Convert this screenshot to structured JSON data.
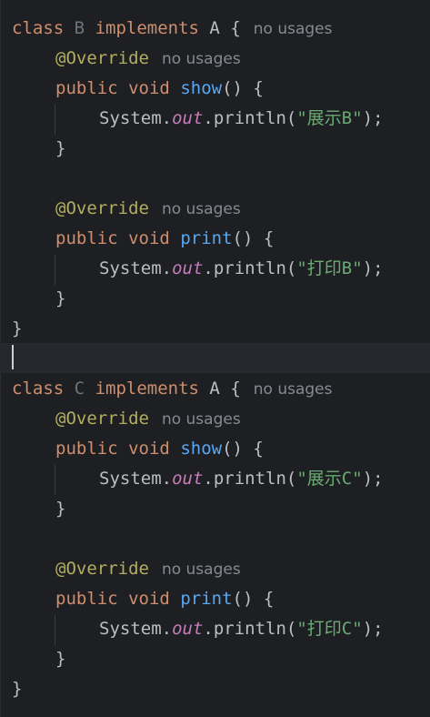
{
  "editor": {
    "language": "java",
    "theme_colors": {
      "background": "#1e1f22",
      "current_line": "#26282e",
      "keyword": "#cf8e6d",
      "annotation": "#b3ae60",
      "method_declaration": "#56a8f5",
      "static_field": "#c77dba",
      "string": "#6aab73",
      "inlay_hint": "#868a91"
    },
    "hint_no_usages": "no usages",
    "class_b": {
      "keyword_class": "class",
      "name": "B",
      "keyword_implements": "implements",
      "interface": "A",
      "open_brace": "{",
      "methods": [
        {
          "annotation": "@Override",
          "modifier": "public",
          "return_type": "void",
          "name": "show",
          "sig_rest": "() {",
          "stmt_prefix": "System.",
          "stmt_field": "out",
          "stmt_call": ".println(",
          "stmt_string": "\"展示B\"",
          "stmt_end": ");",
          "close_brace": "}"
        },
        {
          "annotation": "@Override",
          "modifier": "public",
          "return_type": "void",
          "name": "print",
          "sig_rest": "() {",
          "stmt_prefix": "System.",
          "stmt_field": "out",
          "stmt_call": ".println(",
          "stmt_string": "\"打印B\"",
          "stmt_end": ");",
          "close_brace": "}"
        }
      ],
      "close_brace": "}"
    },
    "class_c": {
      "keyword_class": "class",
      "name": "C",
      "keyword_implements": "implements",
      "interface": "A",
      "open_brace": "{",
      "methods": [
        {
          "annotation": "@Override",
          "modifier": "public",
          "return_type": "void",
          "name": "show",
          "sig_rest": "() {",
          "stmt_prefix": "System.",
          "stmt_field": "out",
          "stmt_call": ".println(",
          "stmt_string": "\"展示C\"",
          "stmt_end": ");",
          "close_brace": "}"
        },
        {
          "annotation": "@Override",
          "modifier": "public",
          "return_type": "void",
          "name": "print",
          "sig_rest": "() {",
          "stmt_prefix": "System.",
          "stmt_field": "out",
          "stmt_call": ".println(",
          "stmt_string": "\"打印C\"",
          "stmt_end": ");",
          "close_brace": "}"
        }
      ],
      "close_brace": "}"
    }
  }
}
